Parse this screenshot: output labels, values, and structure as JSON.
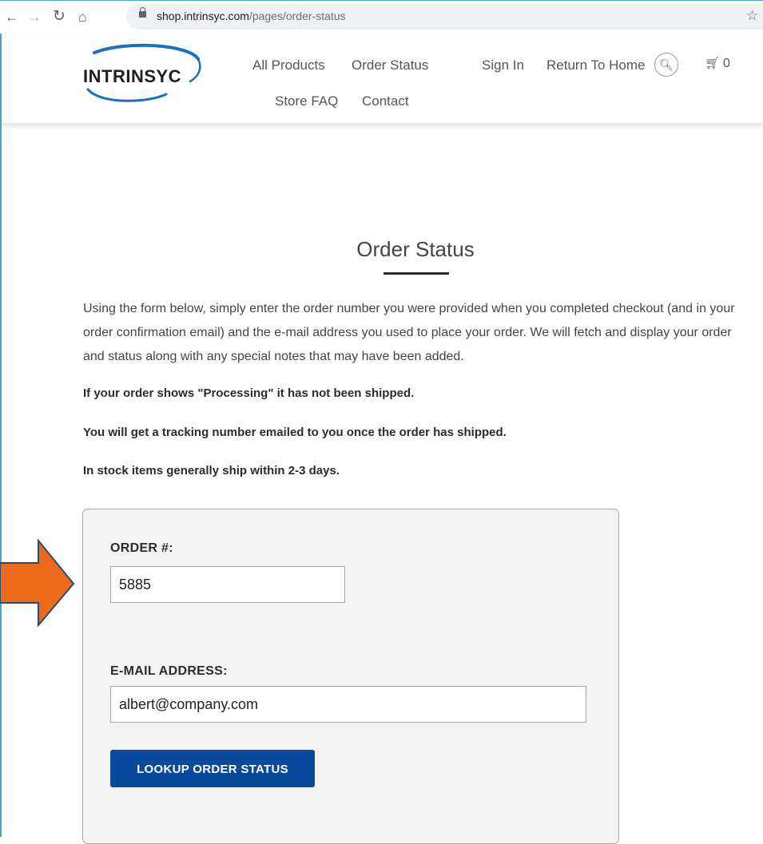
{
  "browser": {
    "url_domain": "shop.intrinsyc.com",
    "url_path": "/pages/order-status"
  },
  "header": {
    "logo_text": "INTRINSYC",
    "nav": {
      "all_products": "All Products",
      "order_status": "Order Status",
      "sign_in": "Sign In",
      "return_home": "Return To Home",
      "store_faq": "Store FAQ",
      "contact": "Contact"
    },
    "cart_count": "0"
  },
  "main": {
    "title": "Order Status",
    "intro": "Using the form below, simply enter the order number you were provided when you completed checkout (and in your order confirmation email) and the e-mail address you used to place your order. We will fetch and display your order and status along with any special notes that may have been added.",
    "notes": [
      "If your order shows \"Processing\" it has not been shipped.",
      "You will get a tracking number emailed to you once the order has shipped.",
      "In stock items generally ship within 2-3 days."
    ]
  },
  "form": {
    "order_label": "ORDER #:",
    "order_value": "5885",
    "email_label": "E-MAIL ADDRESS:",
    "email_value": "albert@company.com",
    "button_label": "LOOKUP ORDER STATUS"
  },
  "colors": {
    "button": "#0a4a9c",
    "arrow": "#ec6a1c",
    "logo_swoosh": "#1a6fc0"
  }
}
